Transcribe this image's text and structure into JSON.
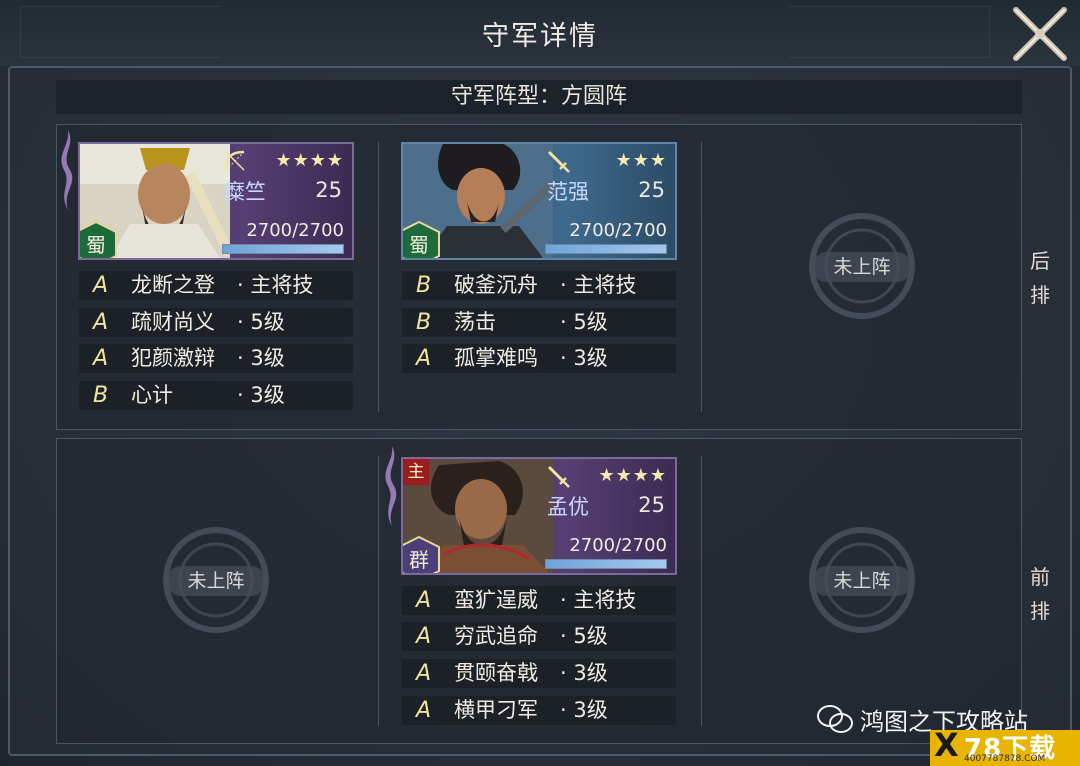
{
  "title": "守军详情",
  "formation": "守军阵型：方圆阵",
  "rows": {
    "back_label": "后排",
    "front_label": "前排"
  },
  "empty_slot_label": "未上阵",
  "generals": [
    {
      "name": "糜竺",
      "level": "25",
      "stars": "★★★★",
      "hp": "2700/2700",
      "hp_fraction": 1.0,
      "faction": "蜀",
      "weapon_icon": "bow-icon",
      "skills": [
        {
          "grade": "A",
          "name": "龙断之登",
          "level": "· 主将技"
        },
        {
          "grade": "A",
          "name": "疏财尚义",
          "level": "· 5级"
        },
        {
          "grade": "A",
          "name": "犯颜激辩",
          "level": "· 3级"
        },
        {
          "grade": "B",
          "name": "心计",
          "level": "· 3级"
        }
      ]
    },
    {
      "name": "范强",
      "level": "25",
      "stars": "★★★",
      "hp": "2700/2700",
      "hp_fraction": 1.0,
      "faction": "蜀",
      "weapon_icon": "sword-icon",
      "skills": [
        {
          "grade": "B",
          "name": "破釜沉舟",
          "level": "· 主将技"
        },
        {
          "grade": "B",
          "name": "荡击",
          "level": "· 5级"
        },
        {
          "grade": "A",
          "name": "孤掌难鸣",
          "level": "· 3级"
        }
      ]
    },
    {
      "name": "孟优",
      "level": "25",
      "stars": "★★★★",
      "hp": "2700/2700",
      "hp_fraction": 1.0,
      "faction": "群",
      "weapon_icon": "sword-icon",
      "lord_badge": "主",
      "skills": [
        {
          "grade": "A",
          "name": "蛮犷逞威",
          "level": "· 主将技"
        },
        {
          "grade": "A",
          "name": "穷武追命",
          "level": "· 5级"
        },
        {
          "grade": "A",
          "name": "贯颐奋戟",
          "level": "· 3级"
        },
        {
          "grade": "A",
          "name": "横甲刁军",
          "level": "· 3级"
        }
      ]
    }
  ],
  "watermark": "鸿图之下攻略站",
  "site_logo": {
    "text": "78下载",
    "url_text": "4007787878.COM",
    "mark": "X"
  },
  "colors": {
    "accent_gold": "#f1e3a0",
    "card_purple": "#563f73",
    "card_blue": "#3e6a8d",
    "lord_red": "#9b1d1d"
  }
}
